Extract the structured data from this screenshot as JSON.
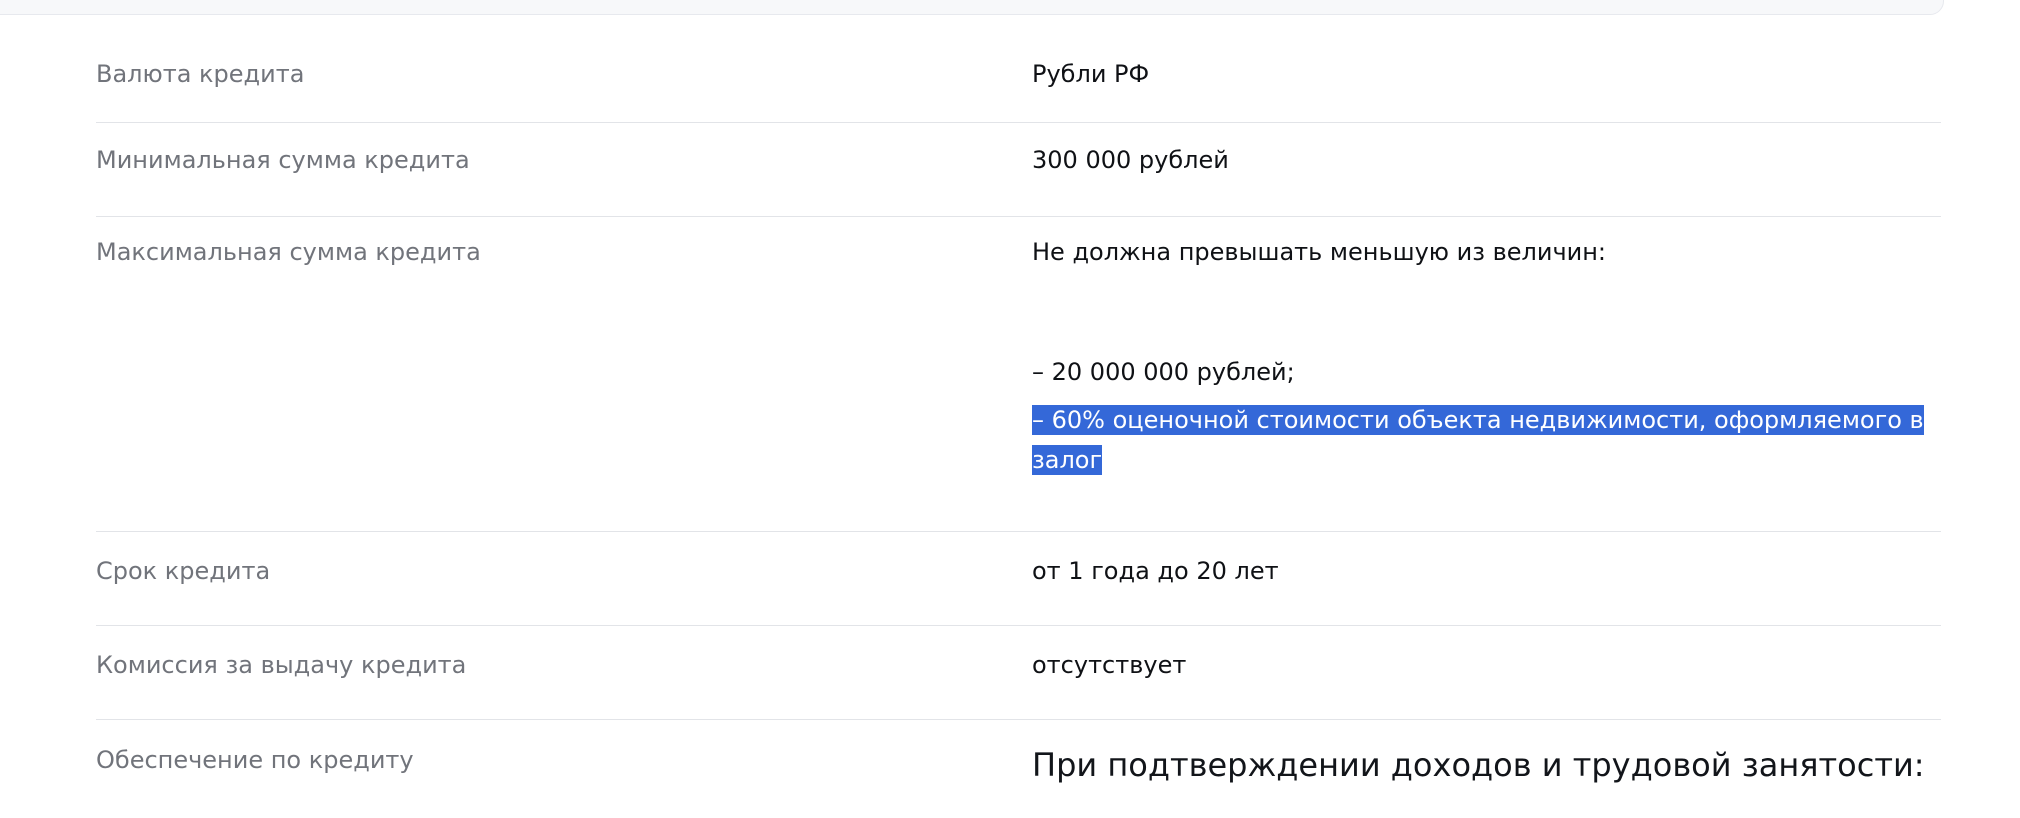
{
  "rows": [
    {
      "label": "Валюта кредита",
      "value": "Рубли РФ"
    },
    {
      "label": "Минимальная сумма кредита",
      "value": "300 000 рублей"
    },
    {
      "label": "Максимальная сумма кредита",
      "value": {
        "intro": "Не должна превышать меньшую из величин:",
        "items": [
          "– 20 000 000 рублей;",
          "– 60% оценочной стоимости объекта недвижимости, оформляемого в залог"
        ]
      }
    },
    {
      "label": "Срок кредита",
      "value": "от 1 года до 20 лет"
    },
    {
      "label": "Комиссия за выдачу кредита",
      "value": "отсутствует"
    },
    {
      "label": "Обеспечение по кредиту",
      "value": "При подтверждении доходов и трудовой занятости:"
    }
  ],
  "selection": {
    "selected_text": "– 60% оценочной стоимости объекта недвижимости, оформляемого в залог",
    "highlight_color": "#3468d8"
  }
}
